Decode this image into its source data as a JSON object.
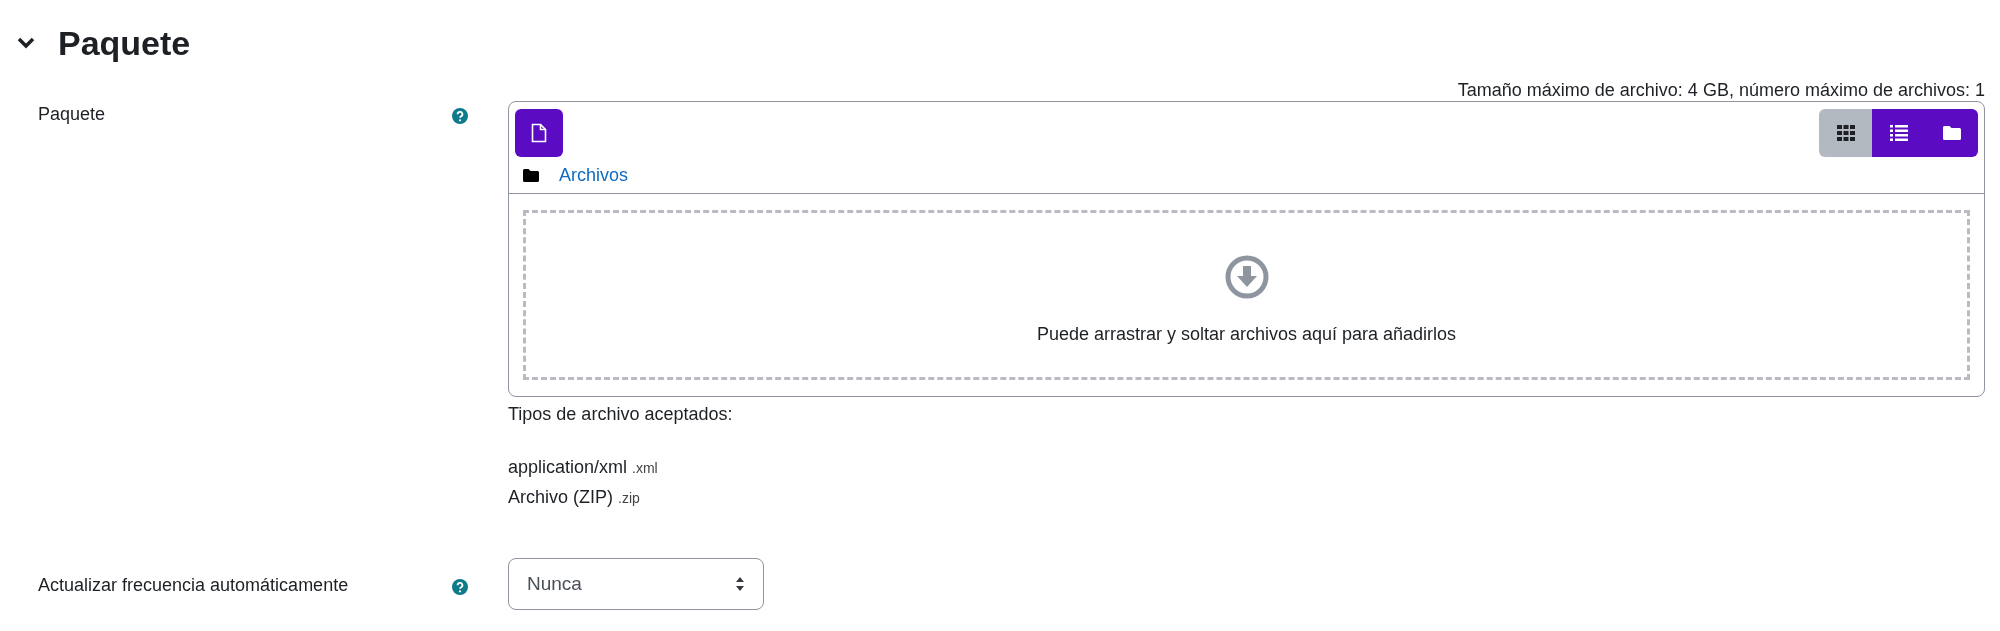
{
  "section": {
    "title": "Paquete",
    "expanded": true
  },
  "package_field": {
    "label": "Paquete",
    "limits": "Tamaño máximo de archivo: 4 GB, número máximo de archivos: 1",
    "view_modes": [
      {
        "kind": "icons",
        "selected": true
      },
      {
        "kind": "list",
        "selected": false
      },
      {
        "kind": "tree",
        "selected": false
      }
    ],
    "breadcrumb": "Archivos",
    "drop_hint": "Puede arrastrar y soltar archivos aquí para añadirlos",
    "accepted_title": "Tipos de archivo aceptados:",
    "accepted_types": [
      {
        "name": "application/xml",
        "extension": ".xml"
      },
      {
        "name": "Archivo (ZIP)",
        "extension": ".zip"
      }
    ]
  },
  "update_field": {
    "label": "Actualizar frecuencia automáticamente",
    "value": "Nunca"
  }
}
